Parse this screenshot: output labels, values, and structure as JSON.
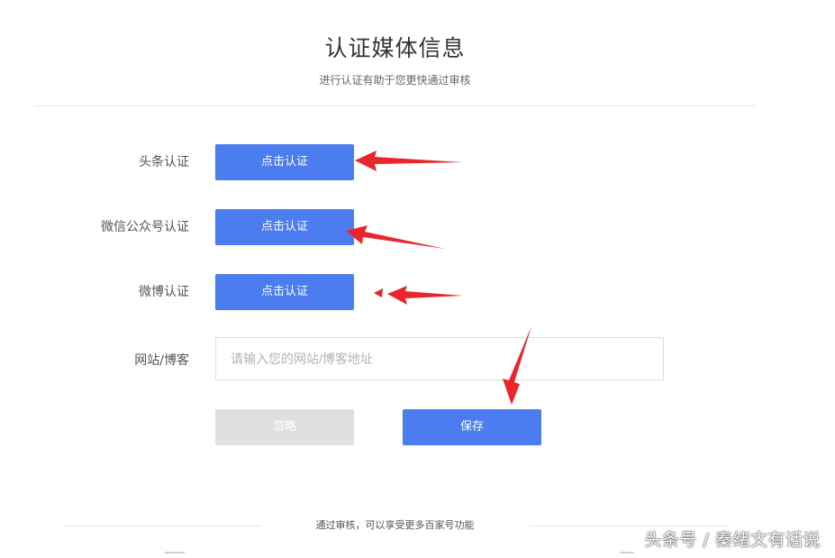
{
  "header": {
    "title": "认证媒体信息",
    "subtitle": "进行认证有助于您更快通过审核"
  },
  "rows": [
    {
      "label": "头条认证",
      "button_label": "点击认证"
    },
    {
      "label": "微信公众号认证",
      "button_label": "点击认证"
    },
    {
      "label": "微博认证",
      "button_label": "点击认证"
    }
  ],
  "website": {
    "label": "网站/博客",
    "placeholder": "请输入您的网站/博客地址",
    "value": ""
  },
  "actions": {
    "ignore_label": "忽略",
    "save_label": "保存"
  },
  "footer": {
    "note": "通过审核，可以享受更多百家号功能"
  },
  "watermark": "头条号 / 秦绪文有话说",
  "colors": {
    "primary_button": "#4b7df0",
    "disabled_button": "#e0e0e3",
    "arrow": "#e8262b"
  }
}
